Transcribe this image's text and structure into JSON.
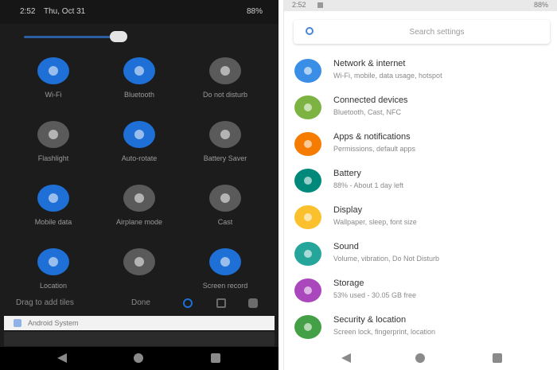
{
  "left_phone": {
    "status_bar": {
      "time": "2:52",
      "date": "Thu, Oct 31",
      "battery": "88%"
    },
    "tiles": [
      {
        "label": "Wi-Fi",
        "icon": "wifi-icon",
        "state": "on"
      },
      {
        "label": "Bluetooth",
        "icon": "bluetooth-icon",
        "state": "on"
      },
      {
        "label": "Do not disturb",
        "icon": "dnd-icon",
        "state": "off"
      },
      {
        "label": "Flashlight",
        "icon": "flashlight-icon",
        "state": "off"
      },
      {
        "label": "Auto-rotate",
        "icon": "rotate-icon",
        "state": "on"
      },
      {
        "label": "Battery Saver",
        "icon": "battery-saver-icon",
        "state": "off"
      },
      {
        "label": "Mobile data",
        "icon": "mobile-data-icon",
        "state": "on"
      },
      {
        "label": "Airplane mode",
        "icon": "airplane-icon",
        "state": "off"
      },
      {
        "label": "Cast",
        "icon": "cast-icon",
        "state": "off"
      },
      {
        "label": "Location",
        "icon": "location-icon",
        "state": "on"
      },
      {
        "label": "",
        "icon": "hotspot-icon",
        "state": "off"
      },
      {
        "label": "Screen record",
        "icon": "screen-record-icon",
        "state": "on"
      }
    ],
    "footer": {
      "edit_label": "Drag to add tiles",
      "done_label": "Done"
    },
    "notification": {
      "text": "Android System"
    }
  },
  "right_phone": {
    "status_bar": {
      "time": "2:52",
      "battery": "88%"
    },
    "search": {
      "placeholder": "Search settings"
    },
    "settings": [
      {
        "title": "Network & internet",
        "subtitle": "Wi-Fi, mobile, data usage, hotspot",
        "color": "#3a8ee6",
        "icon": "wifi-icon"
      },
      {
        "title": "Connected devices",
        "subtitle": "Bluetooth, Cast, NFC",
        "color": "#7cb342",
        "icon": "devices-icon"
      },
      {
        "title": "Apps & notifications",
        "subtitle": "Permissions, default apps",
        "color": "#f57c00",
        "icon": "apps-icon"
      },
      {
        "title": "Battery",
        "subtitle": "88% - About 1 day left",
        "color": "#00897b",
        "icon": "battery-icon"
      },
      {
        "title": "Display",
        "subtitle": "Wallpaper, sleep, font size",
        "color": "#fbc02d",
        "icon": "display-icon"
      },
      {
        "title": "Sound",
        "subtitle": "Volume, vibration, Do Not Disturb",
        "color": "#26a69a",
        "icon": "sound-icon"
      },
      {
        "title": "Storage",
        "subtitle": "53% used - 30.05 GB free",
        "color": "#ab47bc",
        "icon": "storage-icon"
      },
      {
        "title": "Security & location",
        "subtitle": "Screen lock, fingerprint, location",
        "color": "#43a047",
        "icon": "security-icon"
      }
    ]
  }
}
